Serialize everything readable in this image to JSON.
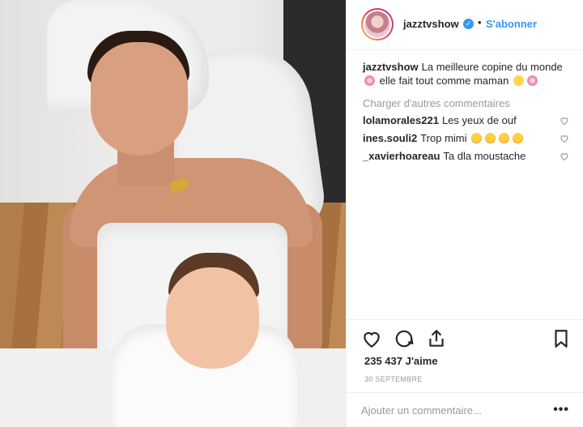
{
  "post": {
    "image_alt": "Photo of woman in white towel with smiling baby wrapped in towel"
  },
  "header": {
    "username": "jazztvshow",
    "verified_icon": "verified-check-icon",
    "separator": "•",
    "follow_label": "S'abonner"
  },
  "caption": {
    "username": "jazztvshow",
    "text_part1": "La meilleure copine du monde",
    "text_part2": "elle fait tout comme maman"
  },
  "load_more_label": "Charger d'autres commentaires",
  "comments": [
    {
      "username": "lolamorales221",
      "text": "Les yeux de ouf"
    },
    {
      "username": "ines.souli2",
      "text": "Trop mimi"
    },
    {
      "username": "_xavierhoareau",
      "text": "Ta dla moustache"
    }
  ],
  "actions": {
    "like_icon": "heart-icon",
    "comment_icon": "comment-icon",
    "share_icon": "share-icon",
    "save_icon": "bookmark-icon"
  },
  "likes_label": "235 437 J'aime",
  "date_label": "30 SEPTEMBRE",
  "add_comment": {
    "placeholder": "Ajouter un commentaire...",
    "more_label": "•••"
  },
  "colors": {
    "link_blue": "#3897f0",
    "text": "#262626",
    "muted": "#999999",
    "border": "#efefef"
  }
}
